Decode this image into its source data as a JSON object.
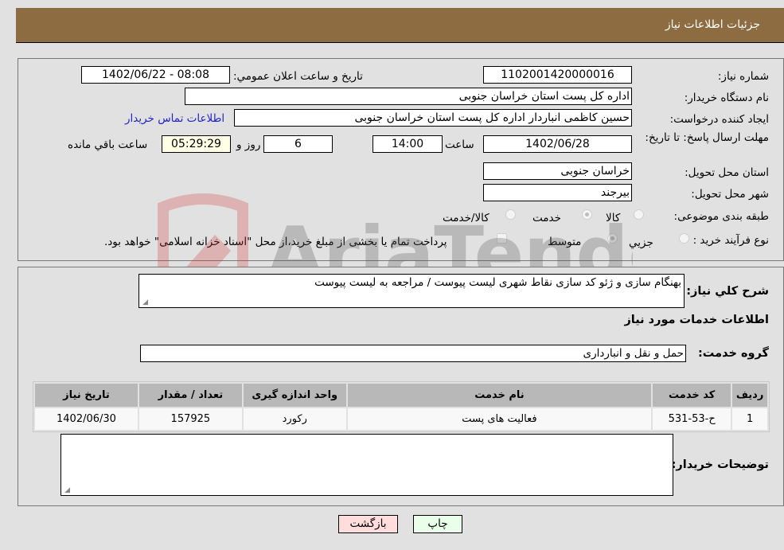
{
  "header": {
    "title": "جزئیات اطلاعات نیاز"
  },
  "details": {
    "need_number": {
      "label": "شماره نیاز:",
      "value": "1102001420000016"
    },
    "announce_datetime": {
      "label": "تاریخ و ساعت اعلان عمومي:",
      "value": "1402/06/22 - 08:08"
    },
    "buyer_org": {
      "label": "نام دستگاه خریدار:",
      "value": "اداره کل پست استان خراسان جنوبی"
    },
    "requester": {
      "label": "ایجاد کننده درخواست:",
      "value": "حسین کاظمی انباردار اداره کل پست استان خراسان جنوبی"
    },
    "buyer_contact_link": "اطلاعات تماس خریدار",
    "deadline": {
      "label": "مهلت ارسال پاسخ: تا تاریخ:",
      "date": "1402/06/28",
      "time_label": "ساعت",
      "time": "14:00",
      "days": "6",
      "days_label": "روز و",
      "remaining": "05:29:29",
      "remaining_label": "ساعت باقي مانده"
    },
    "delivery_province": {
      "label": "استان محل تحویل:",
      "value": "خراسان جنوبی"
    },
    "delivery_city": {
      "label": "شهر محل تحویل:",
      "value": "بیرجند"
    },
    "category": {
      "label": "طبقه بندی موضوعی:",
      "options": [
        "کالا",
        "خدمت",
        "کالا/خدمت"
      ],
      "selected": "خدمت"
    },
    "purchase_type": {
      "label": "نوع فرآیند خرید :",
      "options": [
        "جزيي",
        "متوسط"
      ],
      "selected": "متوسط",
      "treasury_note": "پرداخت تمام یا بخشی از مبلغ خرید،از محل \"اسناد خزانه اسلامی\" خواهد بود.",
      "treasury_checked": false
    }
  },
  "description": {
    "label": "شرح کلي نیاز:",
    "value": "بهنگام سازی و ژئو کد سازی نقاط شهری لیست پیوست / مراجعه به لیست پیوست"
  },
  "services_section": {
    "title": "اطلاعات خدمات مورد نیاز",
    "group_label": "گروه خدمت:",
    "group_value": "حمل و نقل و انبارداری",
    "table": {
      "headers": [
        "ردیف",
        "کد خدمت",
        "نام خدمت",
        "واحد اندازه گیری",
        "تعداد / مقدار",
        "تاریخ نیاز"
      ],
      "rows": [
        [
          "1",
          "ح-53-531",
          "فعالیت های پست",
          "رکورد",
          "157925",
          "1402/06/30"
        ]
      ]
    }
  },
  "buyer_notes": {
    "label": "توضیحات خریدار:",
    "value": ""
  },
  "buttons": {
    "back": "بازگشت",
    "print": "چاپ"
  },
  "watermark": {
    "text": "AriaTender.neT",
    "color": "#d33c3c"
  }
}
